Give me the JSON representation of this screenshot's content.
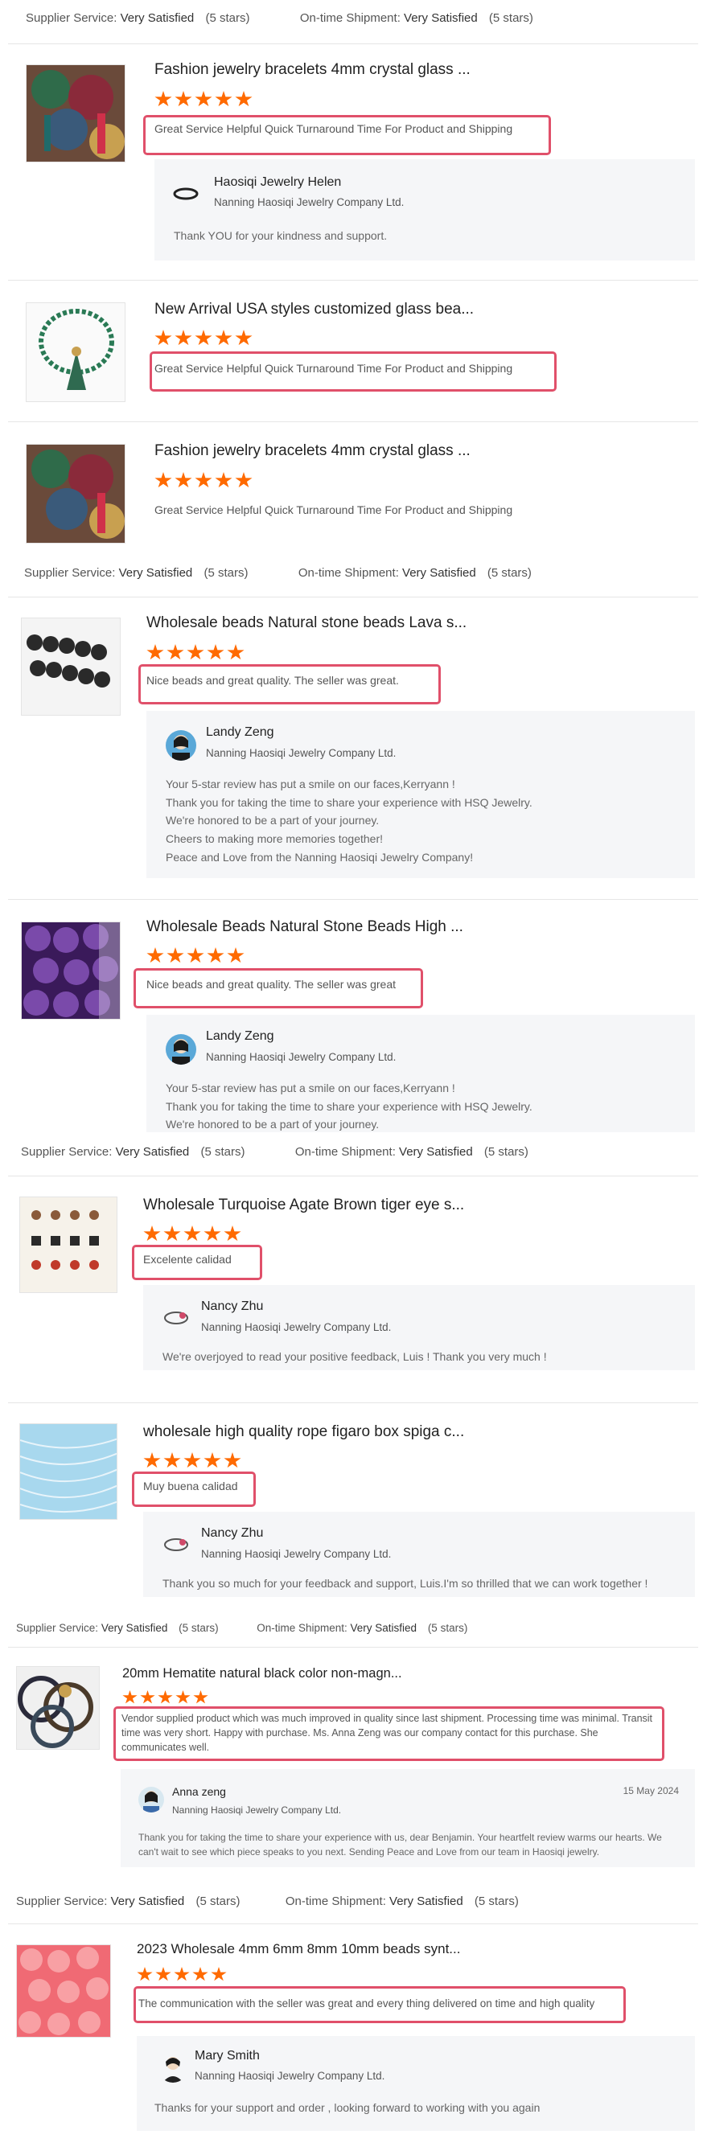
{
  "supplier_service_label": "Supplier Service:",
  "ontime_label": "On-time Shipment:",
  "rating_value": "Very Satisfied",
  "stars_text": "(5 stars)",
  "colors": {
    "star": "#ff6a00",
    "highlight_border": "#e0506a",
    "reply_bg": "#f5f6f8"
  },
  "reviews": [
    {
      "title": "Fashion jewelry bracelets 4mm crystal glass ...",
      "rating": 5,
      "text": "Great Service Helpful Quick Turnaround Time For Product and Shipping",
      "reply": {
        "name": "Haosiqi Jewelry Helen",
        "company": "Nanning Haosiqi Jewelry Company Ltd.",
        "message": "Thank YOU for your kindness and support."
      }
    },
    {
      "title": "New Arrival USA styles customized glass bea...",
      "rating": 5,
      "text": "Great Service Helpful Quick Turnaround Time For Product and Shipping"
    },
    {
      "title": "Fashion jewelry bracelets 4mm crystal glass ...",
      "rating": 5,
      "text": "Great Service Helpful Quick Turnaround Time For Product and Shipping"
    },
    {
      "title": "Wholesale beads Natural stone beads Lava s...",
      "rating": 5,
      "text": "Nice beads and great quality. The seller was great.",
      "reply": {
        "name": "Landy Zeng",
        "company": "Nanning Haosiqi Jewelry Company Ltd.",
        "lines": [
          "Your 5-star review has put a smile on our faces,Kerryann !",
          "Thank you for taking the time to share your experience with HSQ Jewelry.",
          "We're honored to be a part of your journey.",
          "Cheers to making more memories together!",
          "Peace and Love from the Nanning Haosiqi Jewelry Company!"
        ]
      }
    },
    {
      "title": "Wholesale Beads Natural Stone Beads High ...",
      "rating": 5,
      "text": "Nice beads and great quality. The seller was great",
      "reply": {
        "name": "Landy Zeng",
        "company": "Nanning Haosiqi Jewelry Company Ltd.",
        "lines": [
          "Your 5-star review has put a smile on our faces,Kerryann !",
          "Thank you for taking the time to share your experience with HSQ Jewelry.",
          "We're honored to be a part of your journey."
        ]
      }
    },
    {
      "title": "Wholesale Turquoise Agate Brown tiger eye s...",
      "rating": 5,
      "text": "Excelente calidad",
      "reply": {
        "name": "Nancy Zhu",
        "company": "Nanning Haosiqi Jewelry Company Ltd.",
        "message": "We're overjoyed to read your positive feedback, Luis ! Thank you very much !"
      }
    },
    {
      "title": "wholesale high quality rope figaro box spiga c...",
      "rating": 5,
      "text": "Muy buena calidad",
      "reply": {
        "name": "Nancy Zhu",
        "company": "Nanning Haosiqi Jewelry Company Ltd.",
        "message": "Thank you so much for your feedback and support, Luis.I'm so thrilled that we can work together !"
      }
    },
    {
      "title": "20mm Hematite natural black color non-magn...",
      "rating": 5,
      "text": "Vendor supplied product which was much improved in quality since last shipment. Processing time was minimal. Transit time was very short. Happy with purchase. Ms. Anna Zeng was our company contact for this purchase. She communicates well.",
      "reply": {
        "name": "Anna zeng",
        "company": "Nanning Haosiqi Jewelry Company Ltd.",
        "date": "15 May 2024",
        "message": "Thank you for taking the time to share your experience with us, dear Benjamin. Your heartfelt review warms our hearts. We can't wait to see which piece speaks to you next. Sending Peace and Love from our team in Haosiqi jewelry."
      }
    },
    {
      "title": "2023 Wholesale 4mm 6mm 8mm 10mm beads synt...",
      "rating": 5,
      "text": "The communication with the seller was great and every thing delivered on time and high quality",
      "reply": {
        "name": "Mary Smith",
        "company": "Nanning Haosiqi Jewelry Company Ltd.",
        "message": "Thanks for your support and order , looking forward to working with you again"
      }
    }
  ]
}
